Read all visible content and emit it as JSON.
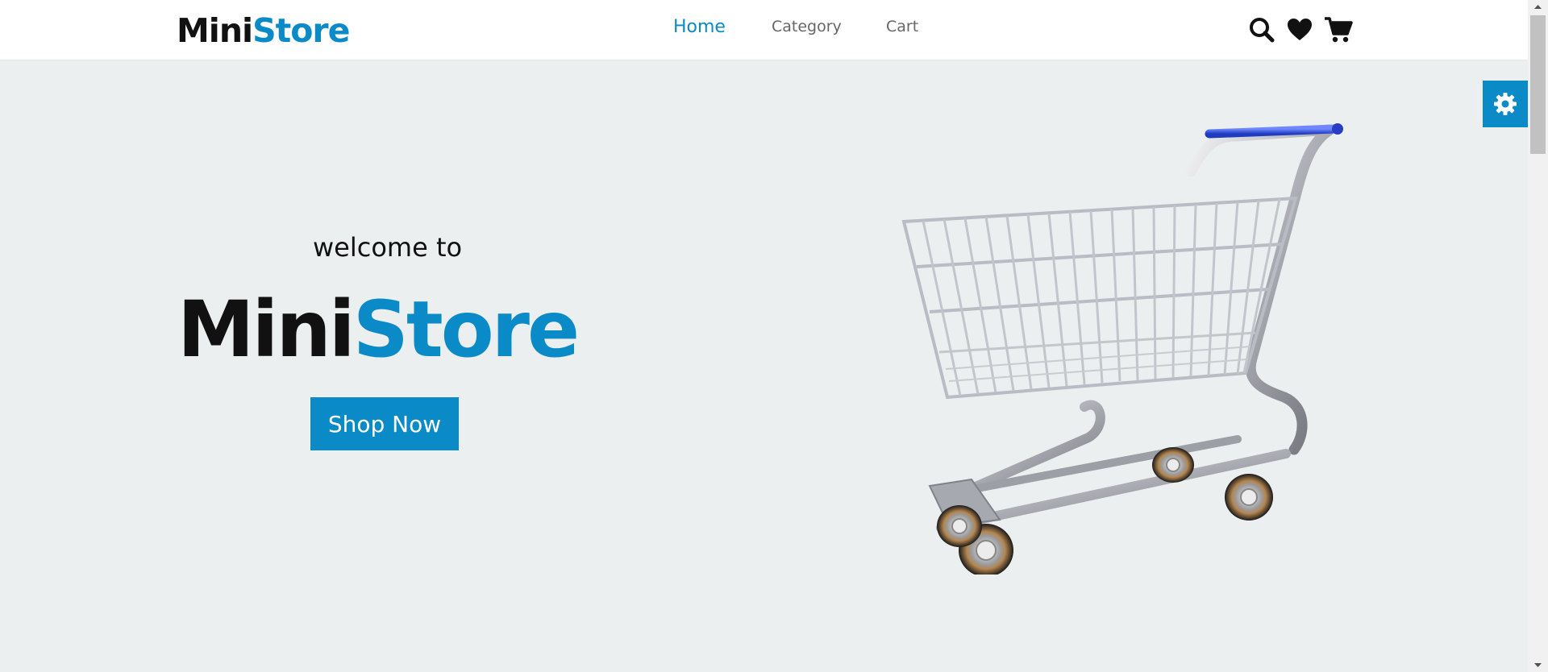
{
  "header": {
    "logo": {
      "part1": "Mini",
      "part2": "Store"
    },
    "nav": [
      {
        "label": "Home",
        "active": true
      },
      {
        "label": "Category",
        "active": false
      },
      {
        "label": "Cart",
        "active": false
      }
    ],
    "icons": [
      "search-icon",
      "heart-icon",
      "cart-icon"
    ]
  },
  "hero": {
    "welcome": "welcome to",
    "title": {
      "part1": "Mini",
      "part2": "Store"
    },
    "button_label": "Shop Now",
    "image": "shopping-cart-illustration"
  },
  "settings": {
    "icon": "gear-icon"
  },
  "colors": {
    "accent": "#0b8ac8",
    "hero_background": "#ebeff0",
    "text": "#111111",
    "nav_text": "#666666"
  }
}
